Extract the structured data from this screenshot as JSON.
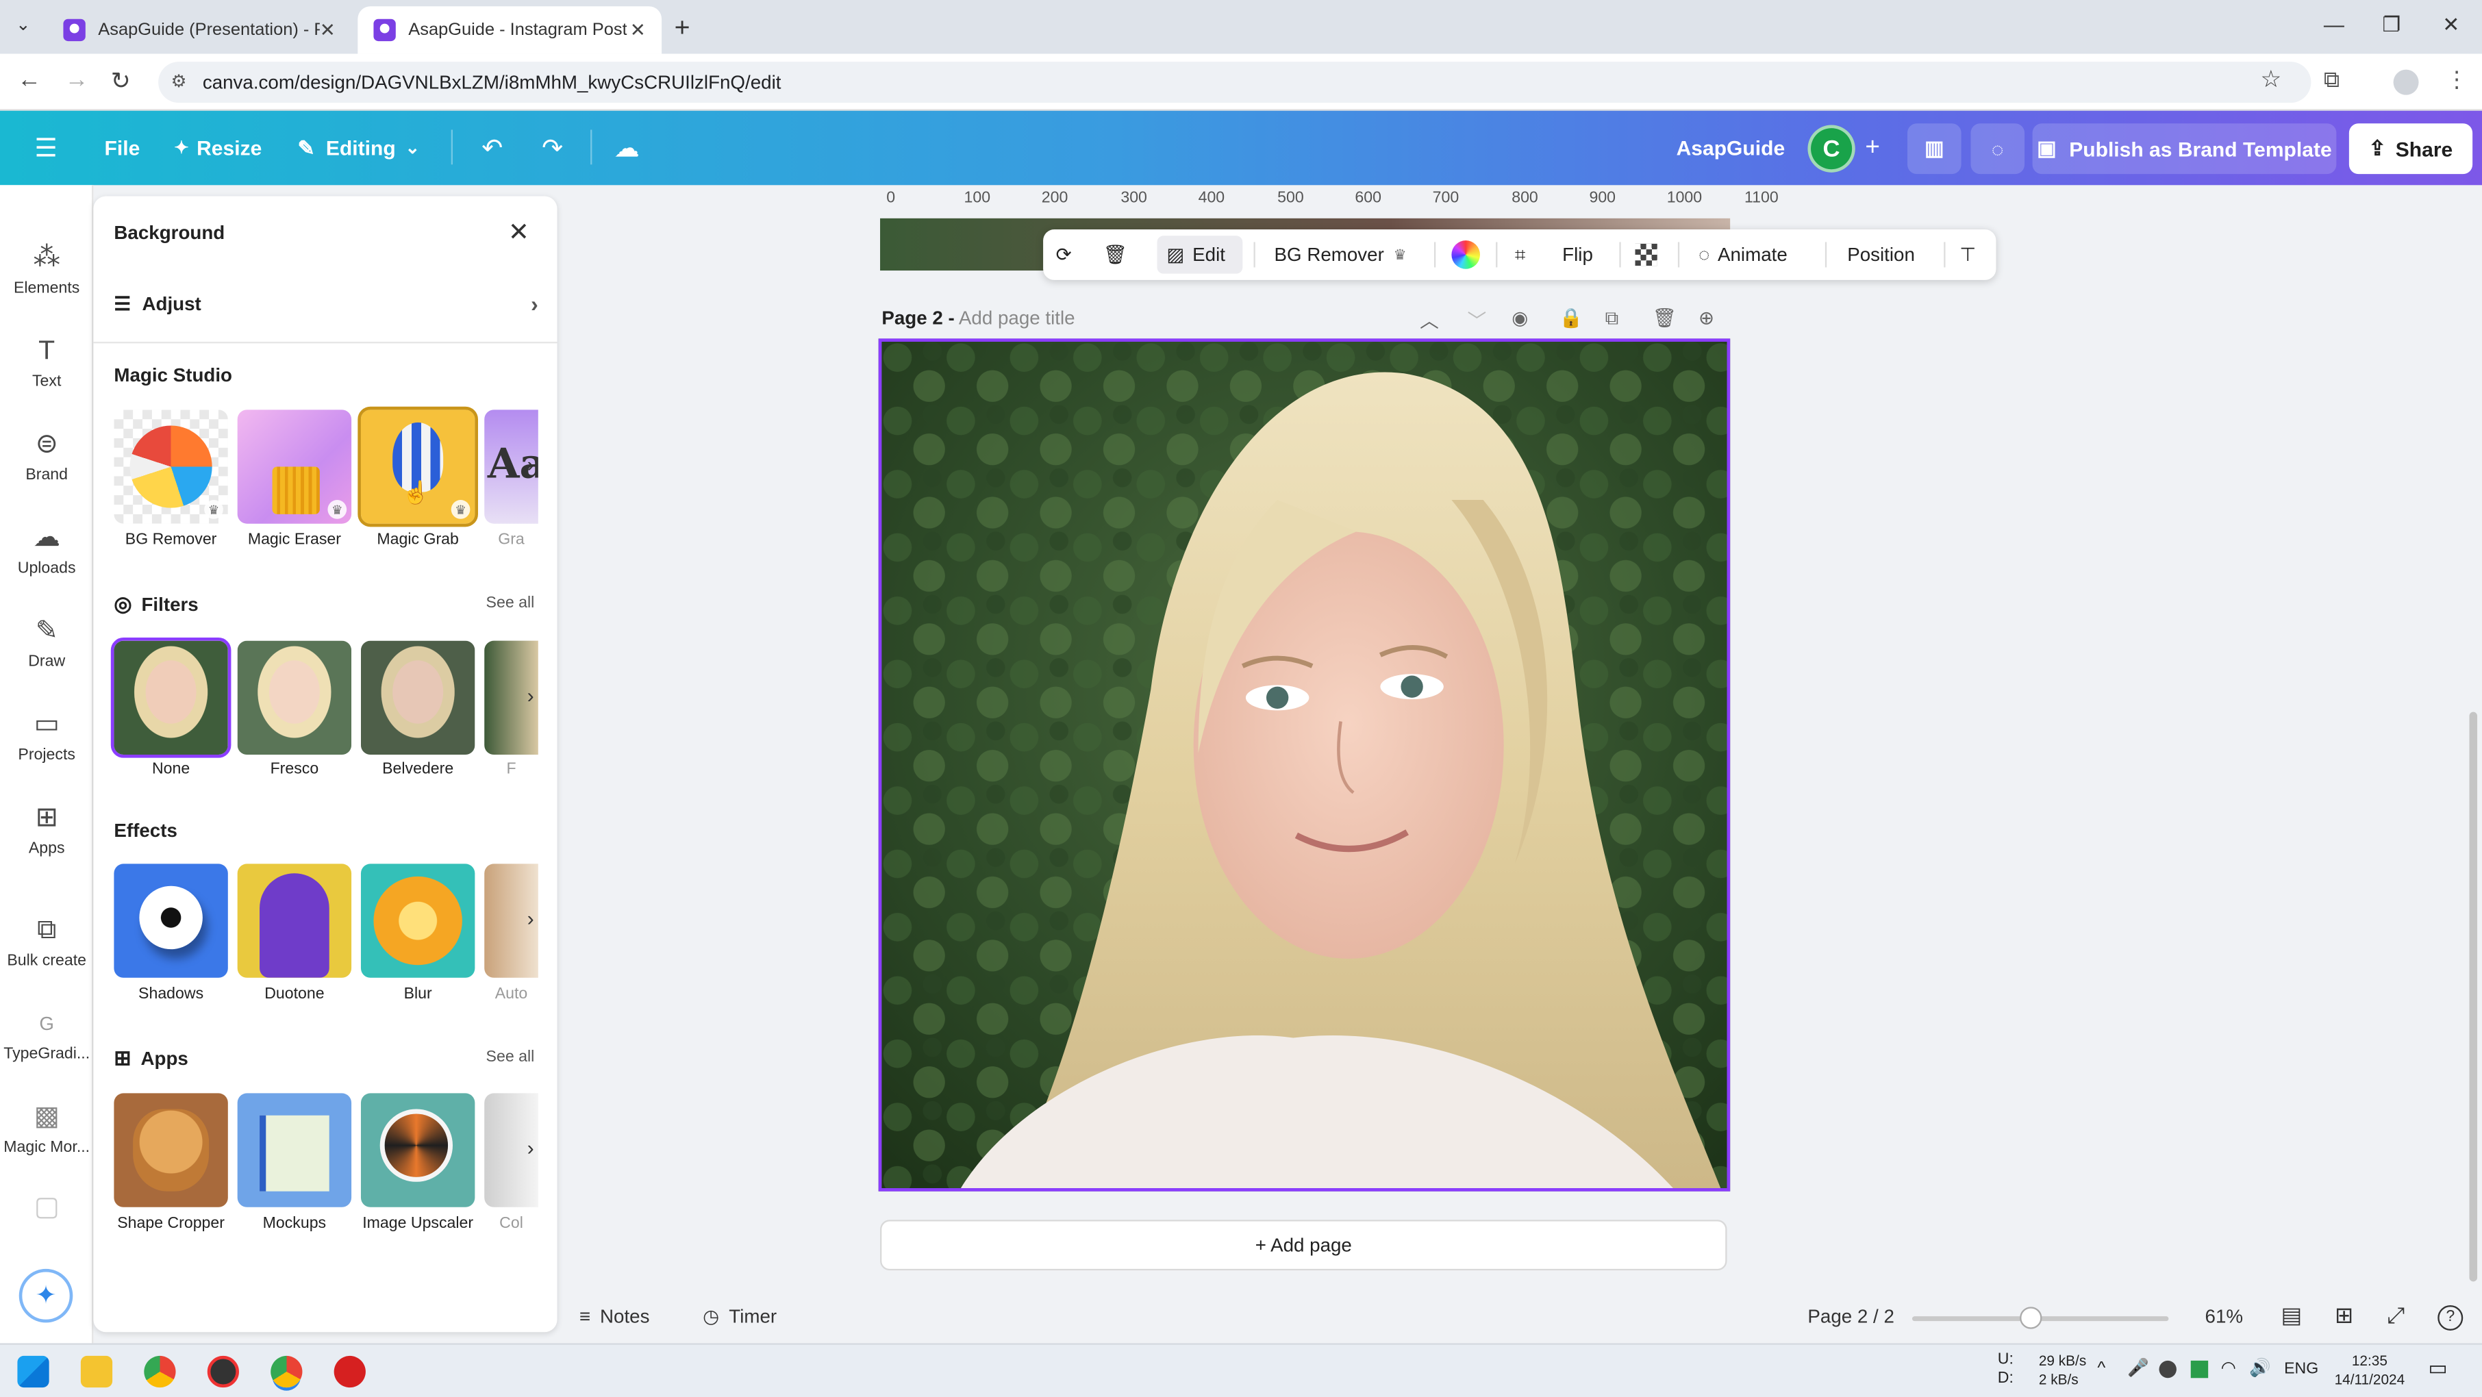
{
  "browser": {
    "tabs": [
      {
        "title": "AsapGuide (Presentation) - Pre",
        "active": false
      },
      {
        "title": "AsapGuide - Instagram Post",
        "active": true
      }
    ],
    "url": "canva.com/design/DAGVNLBxLZM/i8mMhM_kwyCsCRUIlzlFnQ/edit"
  },
  "header": {
    "file": "File",
    "resize": "Resize",
    "editing": "Editing",
    "team": "AsapGuide",
    "avatar_letter": "C",
    "publish": "Publish as Brand Template",
    "share": "Share",
    "gradient_start": "#1ab8d2",
    "gradient_end": "#7d58e8"
  },
  "rail": {
    "items": [
      {
        "label": "Elements",
        "icon": "elements-icon"
      },
      {
        "label": "Text",
        "icon": "text-icon"
      },
      {
        "label": "Brand",
        "icon": "brand-icon"
      },
      {
        "label": "Uploads",
        "icon": "uploads-icon"
      },
      {
        "label": "Draw",
        "icon": "draw-icon"
      },
      {
        "label": "Projects",
        "icon": "projects-icon"
      },
      {
        "label": "Apps",
        "icon": "apps-icon"
      },
      {
        "label": "Bulk create",
        "icon": "bulk-create-icon"
      },
      {
        "label": "TypeGradi...",
        "icon": "typegradient-icon"
      },
      {
        "label": "Magic Mor...",
        "icon": "magic-morph-icon"
      }
    ]
  },
  "panel": {
    "title": "Background",
    "adjust": "Adjust",
    "magic_studio": {
      "title": "Magic Studio",
      "items": [
        "BG Remover",
        "Magic Eraser",
        "Magic Grab",
        "Gra"
      ]
    },
    "filters": {
      "title": "Filters",
      "see_all": "See all",
      "items": [
        "None",
        "Fresco",
        "Belvedere",
        "F"
      ],
      "selected": "None"
    },
    "effects": {
      "title": "Effects",
      "items": [
        "Shadows",
        "Duotone",
        "Blur",
        "Auto"
      ]
    },
    "apps": {
      "title": "Apps",
      "see_all": "See all",
      "items": [
        "Shape Cropper",
        "Mockups",
        "Image Upscaler",
        "Col"
      ]
    }
  },
  "toolbar": {
    "edit": "Edit",
    "bg_remover": "BG Remover",
    "flip": "Flip",
    "animate": "Animate",
    "position": "Position"
  },
  "ruler": [
    "0",
    "100",
    "200",
    "300",
    "400",
    "500",
    "600",
    "700",
    "800",
    "900",
    "1000",
    "1100"
  ],
  "page": {
    "label": "Page 2 -",
    "title_placeholder": "Add page title",
    "add_page": "+ Add page",
    "selection_color": "#8b3dff"
  },
  "bottom": {
    "notes": "Notes",
    "timer": "Timer",
    "page_count": "Page 2 / 2",
    "zoom": "61%"
  },
  "taskbar": {
    "net_up_label": "U:",
    "net_down_label": "D:",
    "net_up": "29 kB/s",
    "net_down": "2 kB/s",
    "lang": "ENG",
    "time": "12:35",
    "date": "14/11/2024"
  }
}
